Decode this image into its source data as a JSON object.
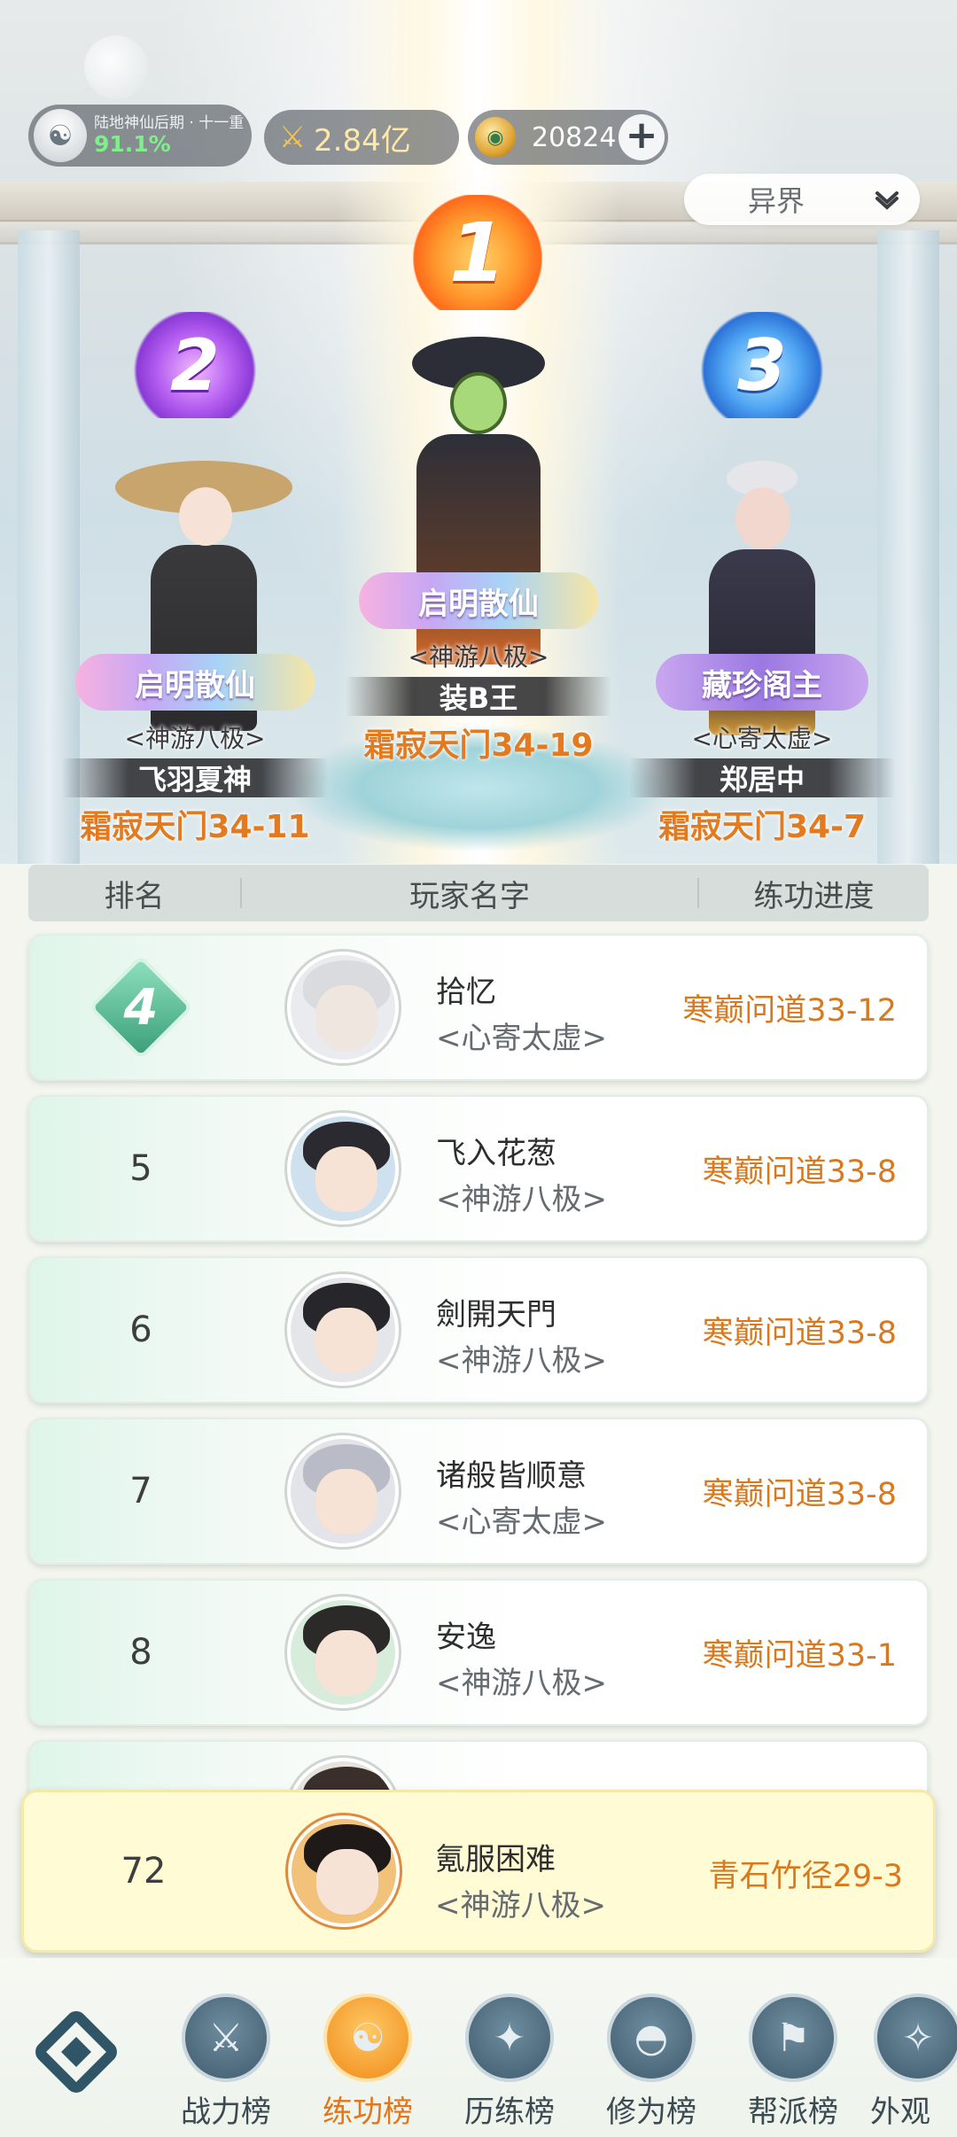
{
  "status": {
    "realm_name": "陆地神仙后期 · 十一重",
    "realm_progress": "91.1%",
    "combat_power": "2.84亿",
    "currency_amount": "20824"
  },
  "server_select": {
    "value": "异界"
  },
  "podium": [
    {
      "rank": "1",
      "title": "启明散仙",
      "guild": "<神游八极>",
      "name": "装B王",
      "progress": "霜寂天门34-19"
    },
    {
      "rank": "2",
      "title": "启明散仙",
      "guild": "<神游八极>",
      "name": "飞羽夏神",
      "progress": "霜寂天门34-11"
    },
    {
      "rank": "3",
      "title": "藏珍阁主",
      "guild": "<心寄太虚>",
      "name": "郑居中",
      "progress": "霜寂天门34-7"
    }
  ],
  "table_header": {
    "rank": "排名",
    "name": "玩家名字",
    "progress": "练功进度"
  },
  "rows": [
    {
      "rank": "4",
      "name": "拾忆",
      "guild": "<心寄太虚>",
      "progress": "寒巅问道33-12"
    },
    {
      "rank": "5",
      "name": "飞入花葱",
      "guild": "<神游八极>",
      "progress": "寒巅问道33-8"
    },
    {
      "rank": "6",
      "name": "劍開天門",
      "guild": "<神游八极>",
      "progress": "寒巅问道33-8"
    },
    {
      "rank": "7",
      "name": "诸般皆顺意",
      "guild": "<心寄太虚>",
      "progress": "寒巅问道33-8"
    },
    {
      "rank": "8",
      "name": "安逸",
      "guild": "<神游八极>",
      "progress": "寒巅问道33-1"
    }
  ],
  "own_row": {
    "rank": "72",
    "name": "氪服困难",
    "guild": "<神游八极>",
    "progress": "青石竹径29-3"
  },
  "nav": {
    "items": [
      {
        "label": "战力榜"
      },
      {
        "label": "练功榜"
      },
      {
        "label": "历练榜"
      },
      {
        "label": "修为榜"
      },
      {
        "label": "帮派榜"
      },
      {
        "label": "外观"
      }
    ]
  }
}
